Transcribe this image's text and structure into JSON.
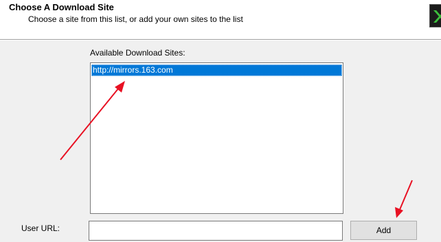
{
  "header": {
    "title": "Choose A Download Site",
    "subtitle": "Choose a site from this list, or add your own sites to the list",
    "icon": "cygwin-setup-icon"
  },
  "sites": {
    "label": "Available Download Sites:",
    "items": [
      {
        "url": "http://mirrors.163.com",
        "selected": true
      }
    ]
  },
  "user_url": {
    "label": "User URL:",
    "value": "",
    "placeholder": ""
  },
  "add_button": {
    "label": "Add"
  },
  "annotations": {
    "arrow_color": "#e81123"
  },
  "colors": {
    "selection": "#0078d7",
    "header_bg": "#ffffff",
    "dialog_bg": "#f0f0f0"
  }
}
